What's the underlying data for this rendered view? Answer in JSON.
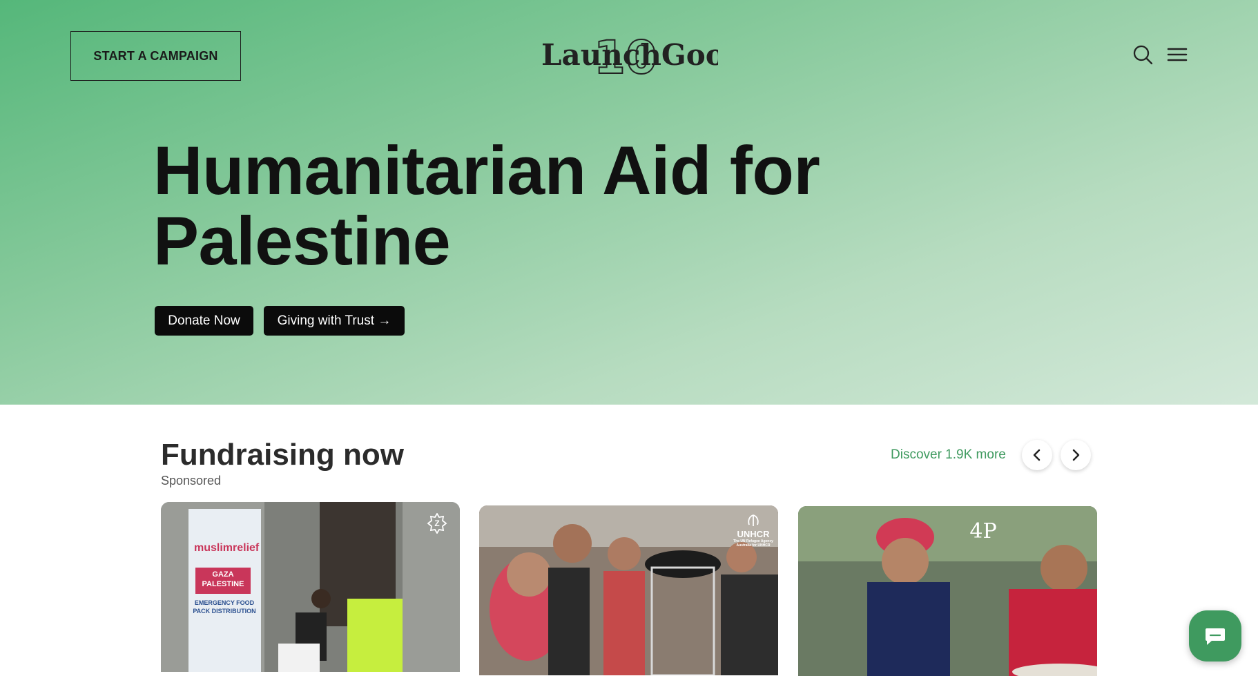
{
  "header": {
    "start_campaign_label": "START A CAMPAIGN",
    "logo_text": "LaunchGood",
    "logo_overlay": "10"
  },
  "hero": {
    "title_line1": "Humanitarian Aid for",
    "title_line2": "Palestine",
    "donate_label": "Donate Now",
    "trust_label": "Giving with Trust →"
  },
  "section": {
    "title": "Fundraising now",
    "subtitle": "Sponsored",
    "discover_label": "Discover 1.9K more"
  },
  "cards": [
    {
      "banner_org": "muslimrelief",
      "banner_tag": "GAZA PALESTINE",
      "banner_sub": "EMERGENCY FOOD PACK DISTRIBUTION",
      "badge": "Z"
    },
    {
      "badge": "UNHCR",
      "badge_sub": "The UN Refugee Agency Australia for UNHCR"
    },
    {
      "badge": "4P"
    }
  ],
  "colors": {
    "accent": "#3f9a5f",
    "hero_top": "#55b77a",
    "hero_bottom": "#d3e8d9",
    "button_dark": "#0b0b0b"
  },
  "icons": {
    "search": "search-icon",
    "menu": "menu-icon",
    "prev": "chevron-left-icon",
    "next": "chevron-right-icon",
    "chat": "chat-icon"
  }
}
